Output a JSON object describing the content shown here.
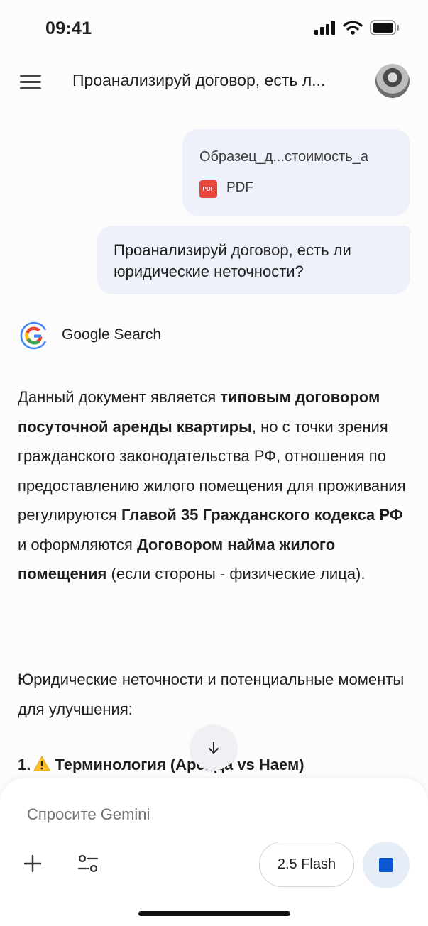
{
  "status_bar": {
    "time": "09:41"
  },
  "header": {
    "title": "Проанализируй договор, есть л..."
  },
  "attachment": {
    "file_name": "Образец_д...стоимость_а",
    "file_type": "PDF",
    "pdf_badge": "PDF"
  },
  "prompt": {
    "text": "Проанализируй договор, есть ли юридические неточности?"
  },
  "tool_chip": {
    "label": "Google Search"
  },
  "response": {
    "p1": {
      "t1": "Данный документ является ",
      "b1": "типовым договором посуточной аренды квартиры",
      "t2": ", но с точки зрения гражданского законодательства РФ, отношения по предоставлению жилого помещения для проживания регулируются ",
      "b2": "Главой 35 Гражданского кодекса РФ",
      "t3": " и оформляются ",
      "b3": "Договором найма жилого помещения",
      "t4": " (если стороны - физические лица)."
    },
    "p2": "Юридические неточности и потенциальные моменты для улучшения:",
    "p3": {
      "number": "1.",
      "text": "Терминология (Аренда vs Наем)"
    }
  },
  "input": {
    "placeholder": "Спросите Gemini"
  },
  "model_selector": {
    "label": "2.5 Flash"
  },
  "colors": {
    "accent": "#0b57d0",
    "bubble": "#eef1f9",
    "pdf": "#e8453c"
  },
  "icons": [
    "menu-icon",
    "signal-icon",
    "wifi-icon",
    "battery-icon",
    "pdf-icon",
    "google-icon",
    "warning-icon",
    "arrow-down-icon",
    "plus-icon",
    "tools-icon",
    "stop-icon"
  ]
}
